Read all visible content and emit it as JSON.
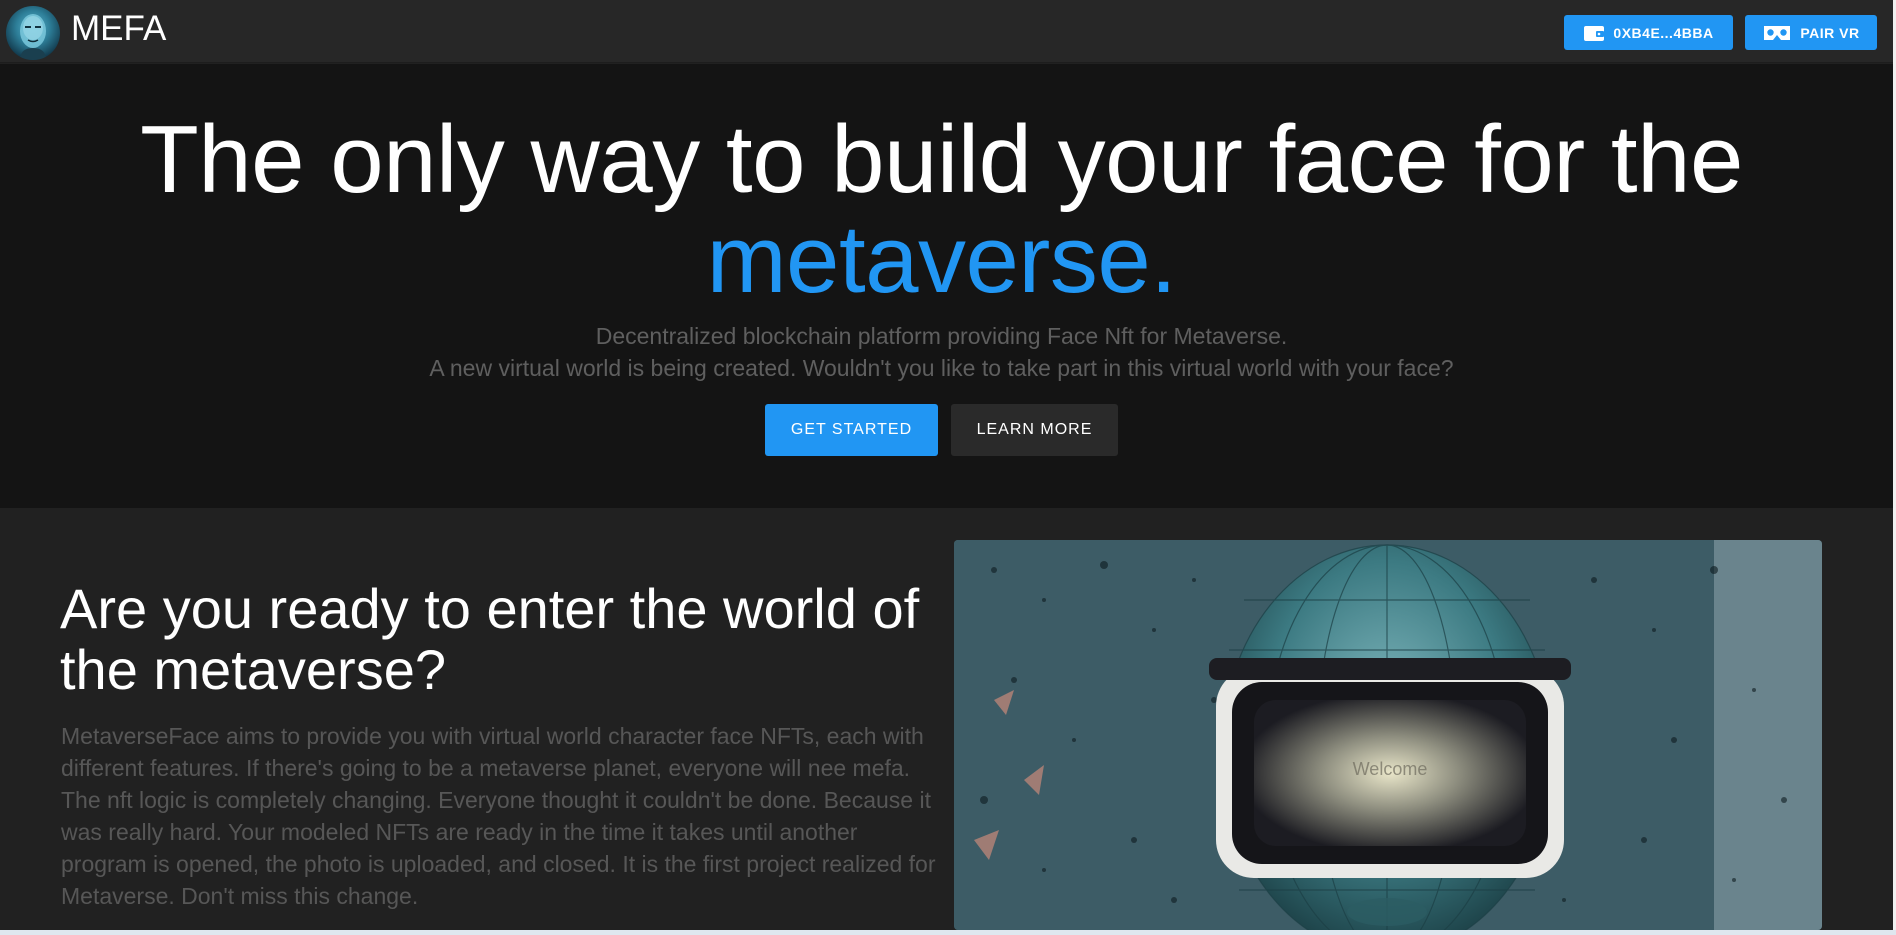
{
  "navbar": {
    "brand": "MEFA",
    "wallet_label": "0XB4E...4BBA",
    "vr_label": "PAIR VR"
  },
  "hero": {
    "title_line1": "The only way to build your face for the",
    "title_accent": "metaverse.",
    "subtitle_line1": "Decentralized blockchain platform providing Face Nft for Metaverse.",
    "subtitle_line2": "A new virtual world is being created. Wouldn't you like to take part in this virtual world with your face?",
    "primary_cta": "GET STARTED",
    "secondary_cta": "LEARN MORE"
  },
  "feature": {
    "heading": "Are you ready to enter the world of the metaverse?",
    "body": "MetaverseFace aims to provide you with virtual world character face NFTs, each with different features. If there's going to be a metaverse planet, everyone will nee mefa. The nft logic is completely changing. Everyone thought it couldn't be done. Because it was really hard. Your modeled NFTs are ready in the time it takes until another program is opened, the photo is uploaded, and closed. It is the first project realized for Metaverse. Don't miss this change.",
    "image_screen_text": "Welcome"
  },
  "colors": {
    "accent": "#2196f3",
    "navbar_bg": "#272727",
    "hero_bg": "#141414",
    "section_bg": "#212121"
  },
  "icons": {
    "logo": "face-avatar-logo",
    "wallet": "wallet-icon",
    "vr": "vr-headset-icon"
  }
}
